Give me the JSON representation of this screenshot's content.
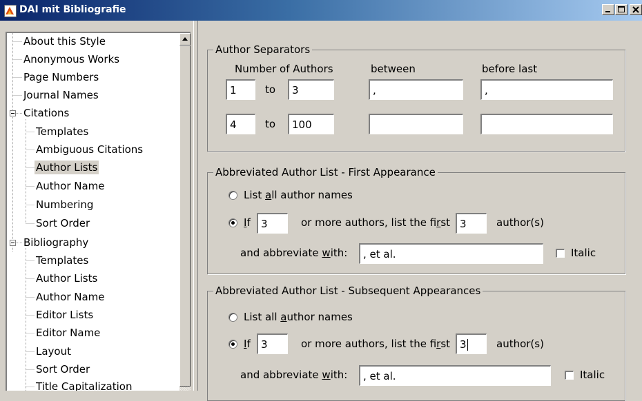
{
  "window": {
    "title": "DAI mit Bibliografie",
    "icon": "endnote-app-icon",
    "controls": [
      "minimize-icon",
      "maximize-icon",
      "close-icon"
    ]
  },
  "tree": {
    "items": [
      {
        "label": "About this Style"
      },
      {
        "label": "Anonymous Works"
      },
      {
        "label": "Page Numbers"
      },
      {
        "label": "Journal Names"
      },
      {
        "label": "Citations",
        "expanded": true
      },
      {
        "label": "Templates"
      },
      {
        "label": "Ambiguous Citations"
      },
      {
        "label": "Author Lists",
        "selected": true
      },
      {
        "label": "Author Name"
      },
      {
        "label": "Numbering"
      },
      {
        "label": "Sort Order"
      },
      {
        "label": "Bibliography",
        "expanded": true
      },
      {
        "label": "Templates"
      },
      {
        "label": "Author Lists"
      },
      {
        "label": "Author Name"
      },
      {
        "label": "Editor Lists"
      },
      {
        "label": "Editor Name"
      },
      {
        "label": "Layout"
      },
      {
        "label": "Sort Order"
      },
      {
        "label": "Title Capitalization"
      }
    ]
  },
  "separators": {
    "legend": "Author Separators",
    "col_number": "Number of Authors",
    "col_between": "between",
    "col_before_last": "before last",
    "to_label": "to",
    "rows": [
      {
        "from": "1",
        "to": "3",
        "between": ",",
        "before_last": ","
      },
      {
        "from": "4",
        "to": "100",
        "between": "",
        "before_last": ""
      }
    ]
  },
  "first": {
    "legend": "Abbreviated Author List - First Appearance",
    "list_all": {
      "pre": "List ",
      "u": "a",
      "post": "ll author names",
      "checked": false
    },
    "if_option": {
      "u": "I",
      "post": "f",
      "checked": true
    },
    "if_value": "3",
    "middle": {
      "pre": "or more authors, list the fi",
      "u": "r",
      "post": "st"
    },
    "first_value": "3",
    "authors_suffix": "author(s)",
    "abbrev": {
      "pre": "and abbreviate ",
      "u": "w",
      "post": "ith:"
    },
    "abbrev_value": ", et al.",
    "italic": {
      "label": "Italic",
      "checked": false
    }
  },
  "subsequent": {
    "legend": "Abbreviated Author List - Subsequent Appearances",
    "list_all": {
      "pre": "List all ",
      "u": "a",
      "post": "uthor names",
      "checked": false
    },
    "if_option": {
      "u": "I",
      "post": "f",
      "checked": true
    },
    "if_value": "3",
    "middle": {
      "pre": "or more authors, list the fi",
      "u": "r",
      "post": "st"
    },
    "first_value": "3",
    "authors_suffix": "author(s)",
    "abbrev": {
      "pre": "and abbreviate ",
      "u": "w",
      "post": "ith:"
    },
    "abbrev_value": ", et al.",
    "italic": {
      "label": "Italic",
      "checked": false
    }
  }
}
